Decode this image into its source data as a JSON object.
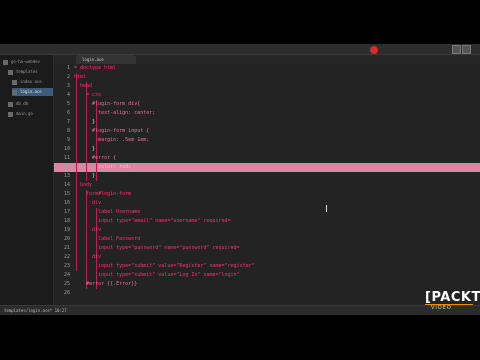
{
  "sidebar": {
    "items": [
      {
        "label": "go-ha-webdev"
      },
      {
        "label": "templates"
      },
      {
        "label": "index.ace"
      },
      {
        "label": "login.ace"
      },
      {
        "label": "db.db"
      },
      {
        "label": "main.go"
      }
    ]
  },
  "tab": {
    "label": "login.ace"
  },
  "editor": {
    "line_numbers": [
      "1",
      "2",
      "3",
      "4",
      "5",
      "6",
      "7",
      "8",
      "9",
      "10",
      "11",
      "12",
      "13",
      "14",
      "15",
      "16",
      "17",
      "18",
      "19",
      "20",
      "21",
      "22",
      "23",
      "24",
      "25",
      "26"
    ],
    "lines": [
      "= doctype html",
      "html",
      "  head",
      "    = css",
      "      #login-form div{",
      "        text-align: center;",
      "      }",
      "      #login-form input {",
      "        margin: .5em 1em;",
      "      }",
      "      #error {",
      "        color: red;",
      "      }",
      "  body",
      "    form#login-form",
      "      div",
      "        label Username",
      "        input type=\"email\" name=\"username\" required=",
      "      div",
      "        label Password",
      "        input type=\"password\" name=\"password\" required=",
      "      div",
      "        input type=\"submit\" value=\"Register\" name=\"register\"",
      "        input type=\"submit\" value=\"Log In\" name=\"login\"",
      "    #error {{.Error}}",
      ""
    ]
  },
  "status": {
    "text": "templates/login.ace*  10:27"
  },
  "brand": {
    "main": "[PACKT]",
    "sub": "VIDEO"
  },
  "colors": {
    "accent": "#f48fb1",
    "close": "#d92b2b",
    "keyword": "#ff2f6e"
  }
}
